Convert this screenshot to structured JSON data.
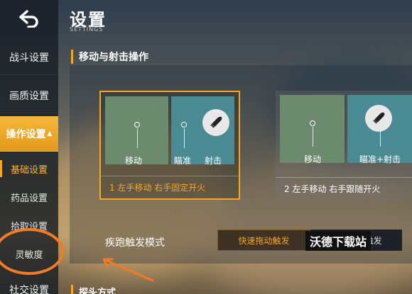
{
  "header": {
    "title": "设置",
    "subtitle": "SETTINGS"
  },
  "sidebar": {
    "items": [
      {
        "label": "战斗设置"
      },
      {
        "label": "画质设置"
      },
      {
        "label": "操作设置",
        "indicator": "▲"
      },
      {
        "label": "基础设置"
      },
      {
        "label": "药品设置"
      },
      {
        "label": "拾取设置"
      },
      {
        "label": "灵敏度"
      },
      {
        "label": "社交设置"
      }
    ]
  },
  "section": {
    "title": "移动与射击操作",
    "next_title": "探头方式"
  },
  "options": [
    {
      "move_label": "移动",
      "aim_label": "瞄准",
      "fire_label": "射击",
      "caption": "1 左手移动 右手固定开火"
    },
    {
      "move_label": "移动",
      "aim_fire_label": "瞄准+射击",
      "caption": "2 左手移动 右手跟随开火"
    }
  ],
  "sprint": {
    "label": "疾跑触发模式",
    "option_on": "快速拖动触发",
    "option_off": "疾跑按键触发"
  },
  "watermark": "沃德下载站",
  "colors": {
    "accent": "#f5a623",
    "annotation": "#f27b25"
  }
}
